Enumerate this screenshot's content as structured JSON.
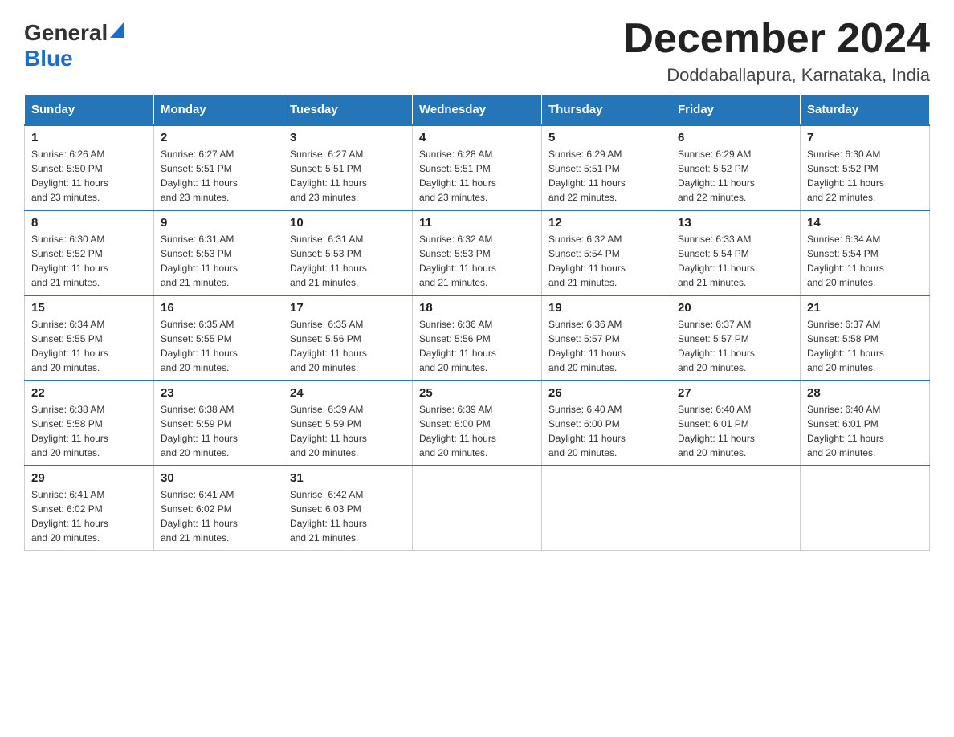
{
  "header": {
    "logo_general": "General",
    "logo_blue": "Blue",
    "month_title": "December 2024",
    "location": "Doddaballapura, Karnataka, India"
  },
  "days_of_week": [
    "Sunday",
    "Monday",
    "Tuesday",
    "Wednesday",
    "Thursday",
    "Friday",
    "Saturday"
  ],
  "weeks": [
    [
      {
        "day": "1",
        "sunrise": "6:26 AM",
        "sunset": "5:50 PM",
        "daylight": "11 hours and 23 minutes."
      },
      {
        "day": "2",
        "sunrise": "6:27 AM",
        "sunset": "5:51 PM",
        "daylight": "11 hours and 23 minutes."
      },
      {
        "day": "3",
        "sunrise": "6:27 AM",
        "sunset": "5:51 PM",
        "daylight": "11 hours and 23 minutes."
      },
      {
        "day": "4",
        "sunrise": "6:28 AM",
        "sunset": "5:51 PM",
        "daylight": "11 hours and 23 minutes."
      },
      {
        "day": "5",
        "sunrise": "6:29 AM",
        "sunset": "5:51 PM",
        "daylight": "11 hours and 22 minutes."
      },
      {
        "day": "6",
        "sunrise": "6:29 AM",
        "sunset": "5:52 PM",
        "daylight": "11 hours and 22 minutes."
      },
      {
        "day": "7",
        "sunrise": "6:30 AM",
        "sunset": "5:52 PM",
        "daylight": "11 hours and 22 minutes."
      }
    ],
    [
      {
        "day": "8",
        "sunrise": "6:30 AM",
        "sunset": "5:52 PM",
        "daylight": "11 hours and 21 minutes."
      },
      {
        "day": "9",
        "sunrise": "6:31 AM",
        "sunset": "5:53 PM",
        "daylight": "11 hours and 21 minutes."
      },
      {
        "day": "10",
        "sunrise": "6:31 AM",
        "sunset": "5:53 PM",
        "daylight": "11 hours and 21 minutes."
      },
      {
        "day": "11",
        "sunrise": "6:32 AM",
        "sunset": "5:53 PM",
        "daylight": "11 hours and 21 minutes."
      },
      {
        "day": "12",
        "sunrise": "6:32 AM",
        "sunset": "5:54 PM",
        "daylight": "11 hours and 21 minutes."
      },
      {
        "day": "13",
        "sunrise": "6:33 AM",
        "sunset": "5:54 PM",
        "daylight": "11 hours and 21 minutes."
      },
      {
        "day": "14",
        "sunrise": "6:34 AM",
        "sunset": "5:54 PM",
        "daylight": "11 hours and 20 minutes."
      }
    ],
    [
      {
        "day": "15",
        "sunrise": "6:34 AM",
        "sunset": "5:55 PM",
        "daylight": "11 hours and 20 minutes."
      },
      {
        "day": "16",
        "sunrise": "6:35 AM",
        "sunset": "5:55 PM",
        "daylight": "11 hours and 20 minutes."
      },
      {
        "day": "17",
        "sunrise": "6:35 AM",
        "sunset": "5:56 PM",
        "daylight": "11 hours and 20 minutes."
      },
      {
        "day": "18",
        "sunrise": "6:36 AM",
        "sunset": "5:56 PM",
        "daylight": "11 hours and 20 minutes."
      },
      {
        "day": "19",
        "sunrise": "6:36 AM",
        "sunset": "5:57 PM",
        "daylight": "11 hours and 20 minutes."
      },
      {
        "day": "20",
        "sunrise": "6:37 AM",
        "sunset": "5:57 PM",
        "daylight": "11 hours and 20 minutes."
      },
      {
        "day": "21",
        "sunrise": "6:37 AM",
        "sunset": "5:58 PM",
        "daylight": "11 hours and 20 minutes."
      }
    ],
    [
      {
        "day": "22",
        "sunrise": "6:38 AM",
        "sunset": "5:58 PM",
        "daylight": "11 hours and 20 minutes."
      },
      {
        "day": "23",
        "sunrise": "6:38 AM",
        "sunset": "5:59 PM",
        "daylight": "11 hours and 20 minutes."
      },
      {
        "day": "24",
        "sunrise": "6:39 AM",
        "sunset": "5:59 PM",
        "daylight": "11 hours and 20 minutes."
      },
      {
        "day": "25",
        "sunrise": "6:39 AM",
        "sunset": "6:00 PM",
        "daylight": "11 hours and 20 minutes."
      },
      {
        "day": "26",
        "sunrise": "6:40 AM",
        "sunset": "6:00 PM",
        "daylight": "11 hours and 20 minutes."
      },
      {
        "day": "27",
        "sunrise": "6:40 AM",
        "sunset": "6:01 PM",
        "daylight": "11 hours and 20 minutes."
      },
      {
        "day": "28",
        "sunrise": "6:40 AM",
        "sunset": "6:01 PM",
        "daylight": "11 hours and 20 minutes."
      }
    ],
    [
      {
        "day": "29",
        "sunrise": "6:41 AM",
        "sunset": "6:02 PM",
        "daylight": "11 hours and 20 minutes."
      },
      {
        "day": "30",
        "sunrise": "6:41 AM",
        "sunset": "6:02 PM",
        "daylight": "11 hours and 21 minutes."
      },
      {
        "day": "31",
        "sunrise": "6:42 AM",
        "sunset": "6:03 PM",
        "daylight": "11 hours and 21 minutes."
      },
      null,
      null,
      null,
      null
    ]
  ],
  "labels": {
    "sunrise": "Sunrise:",
    "sunset": "Sunset:",
    "daylight": "Daylight:"
  }
}
